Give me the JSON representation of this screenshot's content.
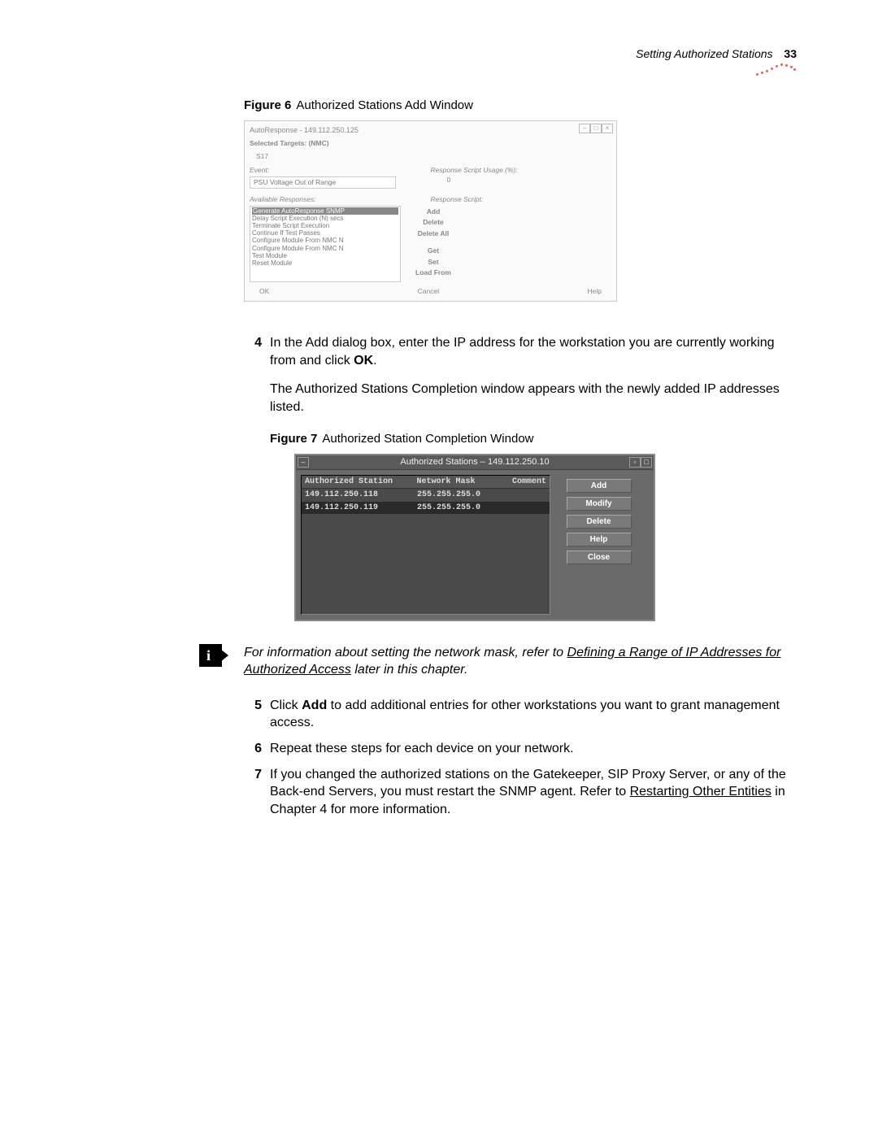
{
  "header": {
    "section": "Setting Authorized Stations",
    "page": "33"
  },
  "fig6": {
    "caption_label": "Figure 6",
    "caption_text": "Authorized Stations Add Window",
    "title": "AutoResponse - 149.112.250.125",
    "selected_targets_label": "Selected Targets:  (NMC)",
    "target": "S17",
    "event_label": "Event:",
    "event_value": "PSU Voltage Out of Range",
    "usage_label": "Response Script Usage (%):",
    "usage_value": "0",
    "avail_label": "Available Responses:",
    "script_label": "Response Script:",
    "responses": [
      "Generate AutoResponse SNMP",
      "Delay Script Execution (N) secs",
      "Terminate Script Execution",
      "Continue If Test Passes",
      "Configure Module From NMC N",
      "Configure Module From NMC N",
      "Test Module",
      "Reset Module"
    ],
    "btns_mid": [
      "Add",
      "Delete",
      "Delete All",
      "",
      "Get",
      "Set",
      "Load From"
    ],
    "foot": {
      "ok": "OK",
      "cancel": "Cancel",
      "help": "Help"
    }
  },
  "step4": {
    "num": "4",
    "line1a": "In the Add dialog box, enter the IP address for the workstation you are currently working from and click ",
    "line1b": "OK",
    "line1c": ".",
    "line2": "The Authorized Stations Completion window appears with the newly added IP addresses listed."
  },
  "fig7": {
    "caption_label": "Figure 7",
    "caption_text": "Authorized Station Completion Window",
    "title": "Authorized Stations – 149.112.250.10",
    "headers": [
      "Authorized Station",
      "Network Mask",
      "Comment"
    ],
    "rows": [
      {
        "station": "149.112.250.118",
        "mask": "255.255.255.0",
        "comment": ""
      },
      {
        "station": "149.112.250.119",
        "mask": "255.255.255.0",
        "comment": ""
      }
    ],
    "buttons": [
      "Add",
      "Modify",
      "Delete",
      "Help",
      "Close"
    ]
  },
  "note": {
    "pre": "For information about setting the network mask, refer to ",
    "link": "Defining a Range of IP Addresses for Authorized Access",
    "post": " later in this chapter."
  },
  "step5": {
    "num": "5",
    "a": "Click ",
    "b": "Add",
    "c": " to add additional entries for other workstations you want to grant management access."
  },
  "step6": {
    "num": "6",
    "t": "Repeat these steps for each device on your network."
  },
  "step7": {
    "num": "7",
    "a": "If you changed the authorized stations on the Gatekeeper, SIP Proxy Server, or any of the Back-end Servers, you must restart the SNMP agent. Refer to ",
    "b": "Restarting Other Entities",
    "c": " in Chapter 4 for more information."
  }
}
